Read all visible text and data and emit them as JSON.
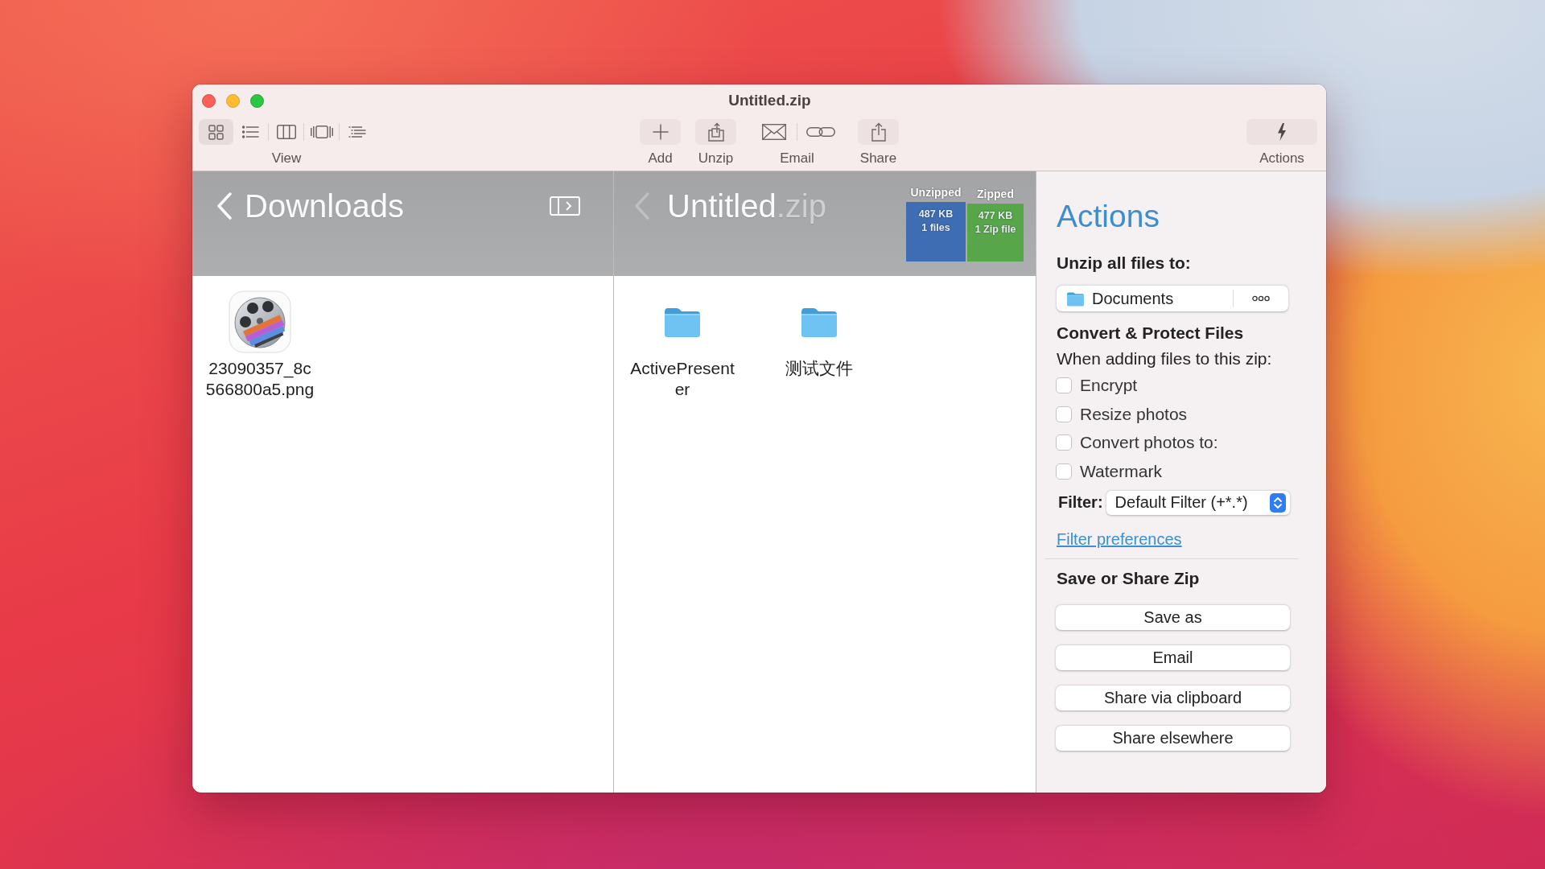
{
  "window": {
    "title": "Untitled.zip"
  },
  "toolbar": {
    "view": {
      "label": "View",
      "modes": [
        {
          "kind": "grid",
          "selected": true
        },
        {
          "kind": "list",
          "selected": false
        },
        {
          "kind": "columns",
          "selected": false
        },
        {
          "kind": "gallery",
          "selected": false
        },
        {
          "kind": "outline",
          "selected": false
        }
      ]
    },
    "buttons": [
      {
        "kind": "add",
        "label": "Add"
      },
      {
        "kind": "unzip",
        "label": "Unzip"
      },
      {
        "kind": "email",
        "label": "Email"
      },
      {
        "kind": "share",
        "label": "Share"
      }
    ],
    "actions": {
      "label": "Actions"
    }
  },
  "downloads_pane": {
    "title": "Downloads",
    "back_disabled": false,
    "files": [
      {
        "kind": "movie",
        "name": "23090357_8c566800a5.png"
      }
    ]
  },
  "archive_pane": {
    "name": "Untitled",
    "extension": ".zip",
    "back_disabled": true,
    "bars": [
      {
        "label": "Unzipped",
        "size": "487 KB",
        "count": "1 files",
        "color": "#3f6db3"
      },
      {
        "label": "Zipped",
        "size": "477 KB",
        "count": "1 Zip file",
        "color": "#58a64a"
      }
    ],
    "files": [
      {
        "kind": "folder",
        "name": "ActivePresenter"
      },
      {
        "kind": "folder",
        "name": "测试文件"
      }
    ]
  },
  "actions_panel": {
    "title": "Actions",
    "unzip_heading": "Unzip all files to:",
    "destination": "Documents",
    "convert_heading": "Convert & Protect Files",
    "convert_note": "When adding files to this zip:",
    "options": [
      {
        "label": "Encrypt",
        "checked": false
      },
      {
        "label": "Resize photos",
        "checked": false
      },
      {
        "label": "Convert photos to:",
        "checked": false
      },
      {
        "label": "Watermark",
        "checked": false
      }
    ],
    "filter_label": "Filter:",
    "filter_value": "Default Filter (+*.*)",
    "link": "Filter preferences",
    "save_heading": "Save or Share Zip",
    "buttons": [
      "Save as",
      "Email",
      "Share via clipboard",
      "Share elsewhere"
    ]
  }
}
